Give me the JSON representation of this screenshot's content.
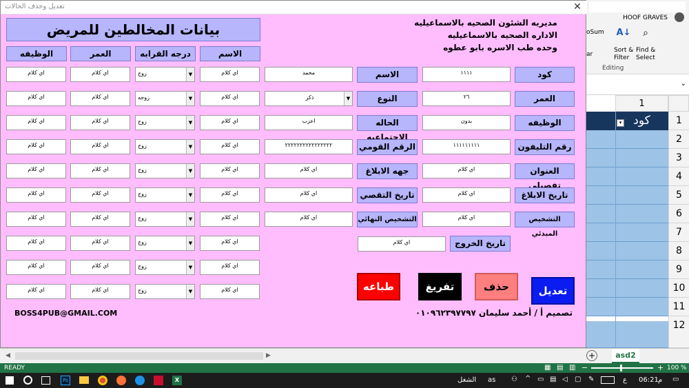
{
  "excel": {
    "user": "HOOF GRAVES",
    "autosum_label": "oSum",
    "clear_label": "ar",
    "sort_label": "Sort &",
    "filter_label": "Filter",
    "find_label": "Find &",
    "select_label": "Select",
    "editing_label": "Editing",
    "column_header": "1",
    "row_numbers": [
      "1",
      "2",
      "3",
      "4",
      "5",
      "6",
      "7",
      "8",
      "9",
      "10",
      "11",
      "12"
    ],
    "a1_value": "كود",
    "sheet_tab": "asd2",
    "status_ready": "READY",
    "zoom": "100 %",
    "colors": {
      "header_row": "#17365d",
      "data_row": "#9dc3e6",
      "status": "#217346"
    }
  },
  "taskbar": {
    "time": "06:21",
    "ampm": "م",
    "lang": "ع",
    "search_text": "الشغل",
    "as_text": "as"
  },
  "form": {
    "title": "تعديل وحذف الحالات",
    "org_line1": "مديريه الشئون الصحيه بالاسماعيليه",
    "org_line2": "الاداره الصحيه بالاسماعيليه",
    "org_line3": "وحده طب الاسره بابو عطوه",
    "contacts_title": "بيانات المخالطين للمريض",
    "contact_headers": [
      "الاسم",
      "درجه القرابه",
      "العمر",
      "الوظيفه"
    ],
    "contacts": [
      {
        "name": "اي كلام",
        "relation": "زوج",
        "age": "اي كلام",
        "job": "اي كلام"
      },
      {
        "name": "اي كلام",
        "relation": "زوجه",
        "age": "اي كلام",
        "job": "اي كلام"
      },
      {
        "name": "اي كلام",
        "relation": "زوج",
        "age": "اي كلام",
        "job": "اي كلام"
      },
      {
        "name": "اي كلام",
        "relation": "زوج",
        "age": "اي كلام",
        "job": "اي كلام"
      },
      {
        "name": "اي كلام",
        "relation": "زوج",
        "age": "اي كلام",
        "job": "اي كلام"
      },
      {
        "name": "اي كلام",
        "relation": "زوج",
        "age": "اي كلام",
        "job": "اي كلام"
      },
      {
        "name": "اي كلام",
        "relation": "زوج",
        "age": "اي كلام",
        "job": "اي كلام"
      },
      {
        "name": "اي كلام",
        "relation": "زوج",
        "age": "اي كلام",
        "job": "اي كلام"
      },
      {
        "name": "اي كلام",
        "relation": "زوج",
        "age": "اي كلام",
        "job": "اي كلام"
      },
      {
        "name": "اي كلام",
        "relation": "زوج",
        "age": "اي كلام",
        "job": "اي كلام"
      }
    ],
    "right_fields": [
      {
        "label": "كود",
        "value": "١١١١"
      },
      {
        "label": "العمر",
        "value": "٢٦"
      },
      {
        "label": "الوظيفه",
        "value": "بدون"
      },
      {
        "label": "رقم التليفون",
        "value": "١١١١١١١١١"
      },
      {
        "label": "العنوان تفصيلي",
        "value": "اي كلام"
      },
      {
        "label": "تاريخ الابلاغ",
        "value": "اي كلام"
      },
      {
        "label": "التشخيص المبدئي",
        "value": "اي كلام"
      }
    ],
    "middle_fields": [
      {
        "label": "الاسم",
        "value": "محمد"
      },
      {
        "label": "النوع",
        "value": "ذكر"
      },
      {
        "label": "الحاله الاجتماعيه",
        "value": "اعزب"
      },
      {
        "label": "الرقم القومي",
        "value": "٢٢٢٢٢٢٢٢٢٢٢٢٢٢٢٢"
      },
      {
        "label": "جهه الابلاغ",
        "value": "اي كلام"
      },
      {
        "label": "تاريخ التقصي",
        "value": "اي كلام"
      },
      {
        "label": "التشخيص النهائي",
        "value": "اي كلام"
      }
    ],
    "exit_label": "تاريخ الخروج",
    "exit_value": "اي كلام",
    "buttons": {
      "edit": "تعديل",
      "delete": "حذف",
      "clear": "تفريغ",
      "print": "طباعه"
    },
    "email": "BOSS4PUB@GMAIL.COM",
    "designer": "تصميم أ / أحمد سليمان ٠١٠٩٦٢٣٩٧٧٩٧"
  }
}
